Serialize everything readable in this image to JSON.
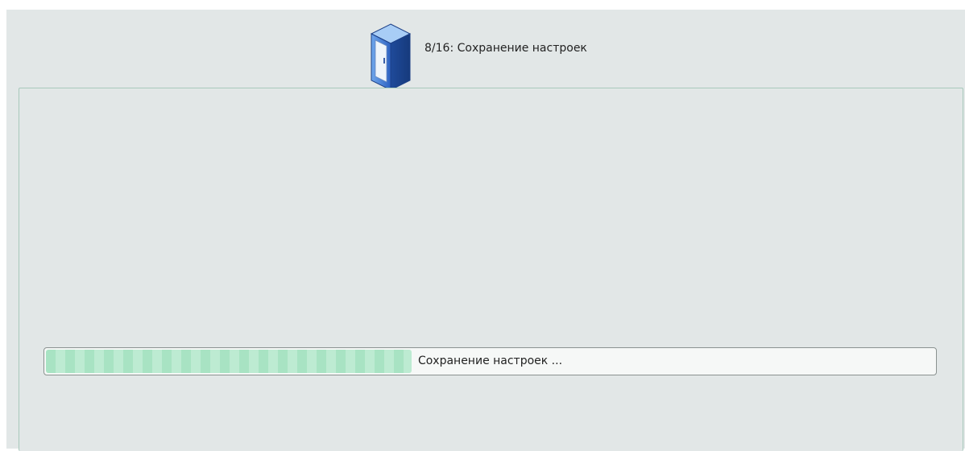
{
  "installer": {
    "step_title": "8/16: Сохранение настроек",
    "step_icon": "computer-case-icon"
  },
  "progress": {
    "label": "Сохранение настроек ...",
    "value": 0.41
  },
  "colors": {
    "background": "#e2e7e7",
    "panel_border": "#a8c9bc",
    "progress_fill": "#a8e3c3",
    "progress_trough": "#f6f8f7"
  }
}
